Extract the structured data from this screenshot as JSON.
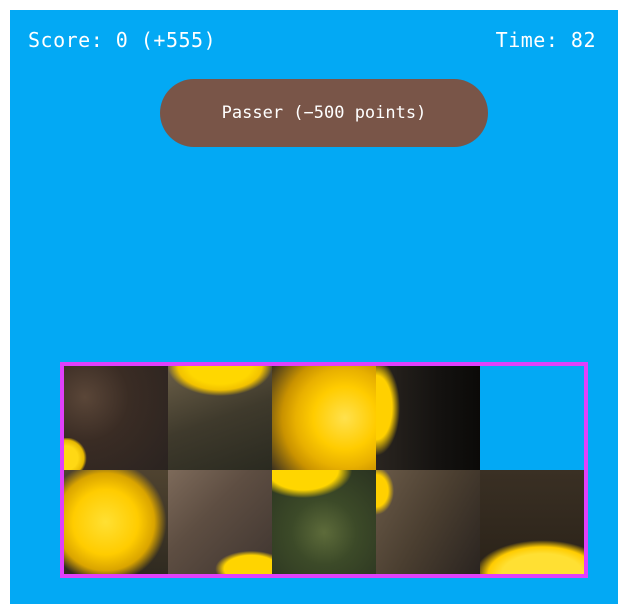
{
  "hud": {
    "score_text": "Score: 0 (+555)",
    "time_text": "Time: 82"
  },
  "skip_button": {
    "label": "Passer (−500 points)"
  },
  "board": {
    "rows": 2,
    "cols": 5,
    "empty_position": [
      1,
      5
    ],
    "border_color": "#e040fb",
    "background_color": "#03a9f4",
    "image_subject": "dandelion flower"
  },
  "colors": {
    "stage_background": "#03a9f4",
    "button_background": "#795548",
    "text": "#ffffff"
  }
}
